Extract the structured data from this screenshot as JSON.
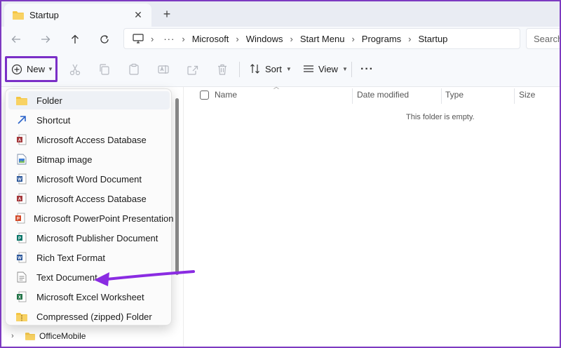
{
  "tab": {
    "title": "Startup",
    "close_glyph": "✕",
    "new_tab_glyph": "+"
  },
  "address": {
    "overflow": "···",
    "segments": [
      "Microsoft",
      "Windows",
      "Start Menu",
      "Programs",
      "Startup"
    ],
    "search_placeholder": "Search"
  },
  "toolbar": {
    "new_label": "New",
    "sort_label": "Sort",
    "view_label": "View",
    "more_glyph": "···"
  },
  "menu": {
    "items": [
      {
        "label": "Folder",
        "icon": "folder-icon"
      },
      {
        "label": "Shortcut",
        "icon": "shortcut-icon"
      },
      {
        "label": "Microsoft Access Database",
        "icon": "access-icon"
      },
      {
        "label": "Bitmap image",
        "icon": "bitmap-icon"
      },
      {
        "label": "Microsoft Word Document",
        "icon": "word-icon"
      },
      {
        "label": "Microsoft Access Database",
        "icon": "access-icon"
      },
      {
        "label": "Microsoft PowerPoint Presentation",
        "icon": "powerpoint-icon"
      },
      {
        "label": "Microsoft Publisher Document",
        "icon": "publisher-icon"
      },
      {
        "label": "Rich Text Format",
        "icon": "rtf-icon"
      },
      {
        "label": "Text Document",
        "icon": "text-document-icon"
      },
      {
        "label": "Microsoft Excel Worksheet",
        "icon": "excel-icon"
      },
      {
        "label": "Compressed (zipped) Folder",
        "icon": "zip-folder-icon"
      }
    ]
  },
  "columns": {
    "name": "Name",
    "date_modified": "Date modified",
    "type": "Type",
    "size": "Size"
  },
  "empty_message": "This folder is empty.",
  "nav_pane": {
    "item": "OfficeMobile"
  },
  "colors": {
    "highlight": "#7a2fc7",
    "arrow": "#8a2be2",
    "folder": "#f4c542"
  }
}
